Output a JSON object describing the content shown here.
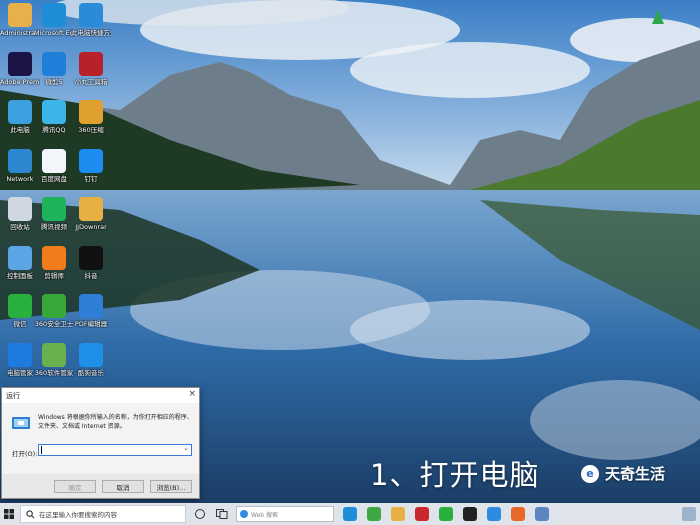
{
  "desktop_icons": [
    {
      "label": "Administra...",
      "icon": "user-folder-icon",
      "color": "#e8b04a"
    },
    {
      "label": "Microsoft Edge",
      "icon": "edge-icon",
      "color": "#1e8fd6"
    },
    {
      "label": "此电脑快捷方式",
      "icon": "shortcut-icon",
      "color": "#2a8bd9"
    },
    {
      "label": "Adobe Premie...",
      "icon": "premiere-icon",
      "color": "#1c1446"
    },
    {
      "label": "微剪5",
      "icon": "m-app-icon",
      "color": "#1f7fd8"
    },
    {
      "label": "小丸工具箱",
      "icon": "wan-icon",
      "color": "#b8202a"
    },
    {
      "label": "此电脑",
      "icon": "computer-icon",
      "color": "#3aa0e0"
    },
    {
      "label": "腾讯QQ",
      "icon": "qq-icon",
      "color": "#3cb4e8"
    },
    {
      "label": "360压缩",
      "icon": "zip-folder-icon",
      "color": "#e0a030"
    },
    {
      "label": "Network",
      "icon": "network-icon",
      "color": "#2f86d0"
    },
    {
      "label": "百度网盘",
      "icon": "baidu-disk-icon",
      "color": "#f2f6fb"
    },
    {
      "label": "钉钉",
      "icon": "dingtalk-icon",
      "color": "#1c8cf0"
    },
    {
      "label": "回收站",
      "icon": "recycle-bin-icon",
      "color": "#cfd8e2"
    },
    {
      "label": "腾讯视频",
      "icon": "tencent-video-icon",
      "color": "#1fb35b"
    },
    {
      "label": "JJDownrar",
      "icon": "folder-icon",
      "color": "#e7b043"
    },
    {
      "label": "控制面板",
      "icon": "control-panel-icon",
      "color": "#5aa6e4"
    },
    {
      "label": "剪辑师",
      "icon": "scissors-icon",
      "color": "#f07c1b"
    },
    {
      "label": "抖音",
      "icon": "douyin-icon",
      "color": "#111111"
    },
    {
      "label": "微信",
      "icon": "wechat-icon",
      "color": "#28b13c"
    },
    {
      "label": "360安全卫士",
      "icon": "security-360-icon",
      "color": "#38a839"
    },
    {
      "label": "PDF编辑器",
      "icon": "pdf-icon",
      "color": "#2f7ed8"
    },
    {
      "label": "电脑管家",
      "icon": "shield-icon",
      "color": "#1e7ce0"
    },
    {
      "label": "360软件管家",
      "icon": "software-manager-icon",
      "color": "#6ab04c"
    },
    {
      "label": "酷狗音乐",
      "icon": "kugou-icon",
      "color": "#1f8fe8"
    }
  ],
  "run_dialog": {
    "title": "运行",
    "close": "×",
    "description": "Windows 将根据你所输入的名称，为你打开相应的程序、文件夹、文档或 Internet 资源。",
    "open_label": "打开(O):",
    "input_value": "",
    "ok_label": "确定",
    "cancel_label": "取消",
    "browse_label": "浏览(B)..."
  },
  "caption": "1、打开电脑",
  "watermark": {
    "mark": "e",
    "text": "天奇生活"
  },
  "taskbar": {
    "search_placeholder": "在这里输入你要搜索的内容",
    "inner_search_text": "Web 搜索",
    "apps": [
      {
        "icon": "edge-icon",
        "color": "#1e8fd6"
      },
      {
        "icon": "360-browser-icon",
        "color": "#3fa844"
      },
      {
        "icon": "explorer-icon",
        "color": "#e7b043"
      },
      {
        "icon": "wps-icon",
        "color": "#c8282e"
      },
      {
        "icon": "wechat-icon",
        "color": "#28b13c"
      },
      {
        "icon": "capcut-icon",
        "color": "#222222"
      },
      {
        "icon": "qq-browser-icon",
        "color": "#2d8ce0"
      },
      {
        "icon": "firefox-icon",
        "color": "#e86a2a"
      },
      {
        "icon": "mail-icon",
        "color": "#5b86c2"
      }
    ]
  }
}
